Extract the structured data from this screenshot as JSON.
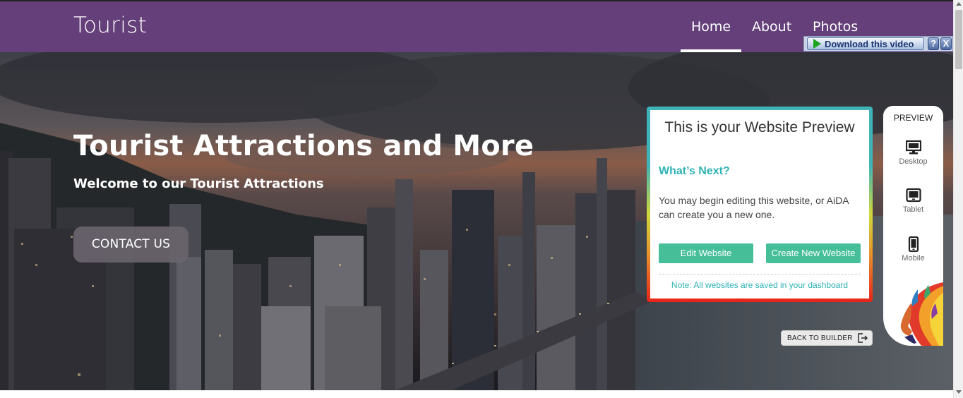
{
  "navbar": {
    "brand": "Tourist",
    "items": [
      {
        "label": "Home",
        "active": true
      },
      {
        "label": "About",
        "active": false
      },
      {
        "label": "Photos",
        "active": false
      }
    ],
    "background": "#643f7a"
  },
  "download_plugin": {
    "label": "Download this video",
    "help": "?",
    "close": "X"
  },
  "hero": {
    "title": "Tourist Attractions and More",
    "subtitle": "Welcome to our Tourist Attractions",
    "cta_label": "CONTACT US"
  },
  "preview_card": {
    "title": "This is your Website Preview",
    "heading": "What’s Next?",
    "body": "You may begin editing this website, or AiDA can create you a new one.",
    "edit_label": "Edit Website",
    "create_label": "Create New Website",
    "note": "Note: All websites are saved in your dashboard",
    "accent_color": "#2eb2b5",
    "button_color": "#46bf99"
  },
  "preview_panel": {
    "title": "PREVIEW",
    "devices": [
      {
        "label": "Desktop",
        "icon": "desktop-icon"
      },
      {
        "label": "Tablet",
        "icon": "tablet-icon"
      },
      {
        "label": "Mobile",
        "icon": "mobile-icon"
      }
    ]
  },
  "back_to_builder": {
    "label": "BACK TO BUILDER",
    "icon": "exit-icon"
  }
}
